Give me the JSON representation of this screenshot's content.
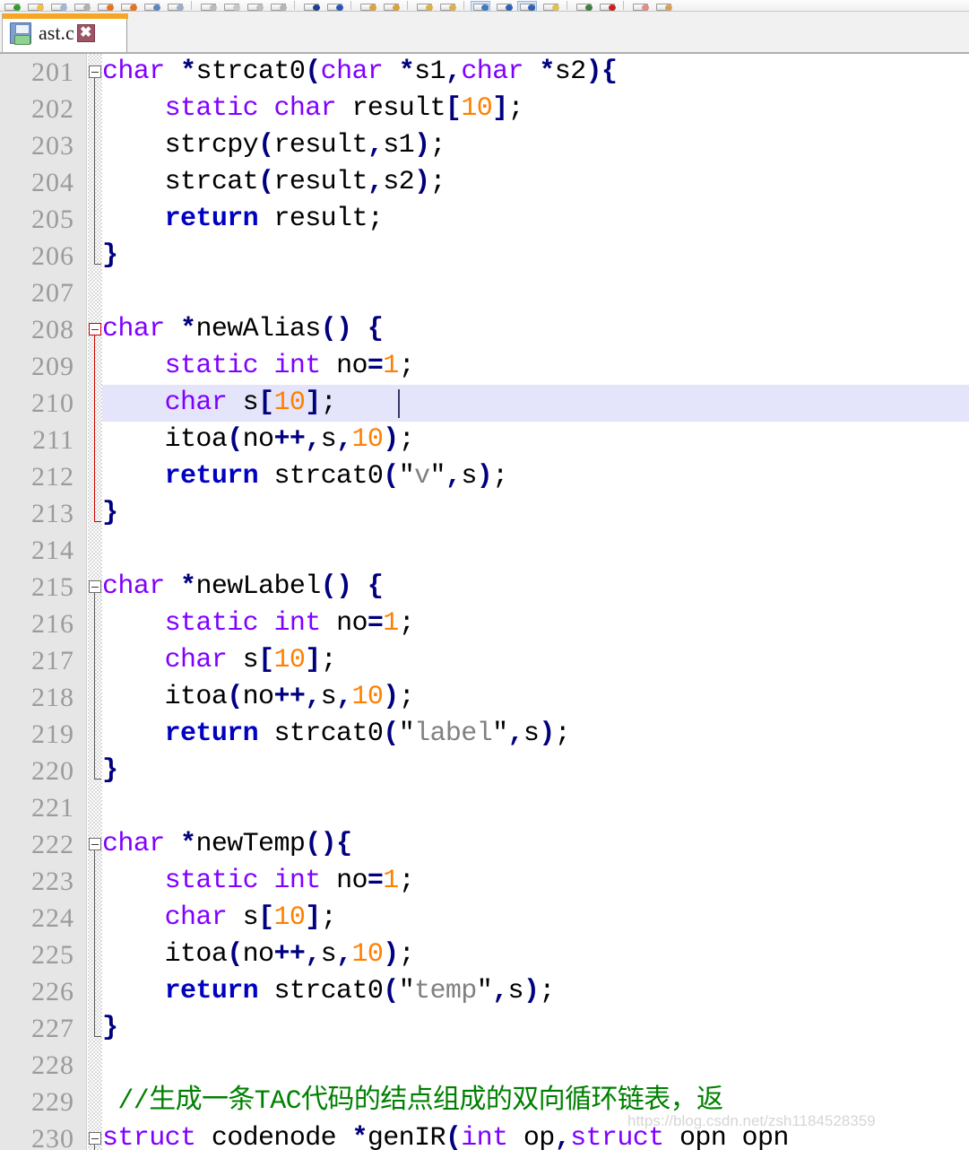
{
  "toolbar": {
    "buttons": [
      {
        "name": "new-file-icon",
        "accent": "#2e9e2e"
      },
      {
        "name": "open-folder-icon",
        "accent": "#f0c040"
      },
      {
        "name": "save-icon",
        "accent": "#9fb8d8"
      },
      {
        "name": "save-all-icon",
        "accent": "#b0b0b0"
      },
      {
        "name": "print-icon",
        "accent": "#e8731c"
      },
      {
        "name": "print-preview-icon",
        "accent": "#e8731c"
      },
      {
        "name": "undo-icon",
        "accent": "#5b86c4"
      },
      {
        "name": "redo-icon",
        "accent": "#9aaec6"
      },
      {
        "name": "cut-icon",
        "accent": "#b9b9b9"
      },
      {
        "name": "copy-icon",
        "accent": "#c7c7c7"
      },
      {
        "name": "paste-icon",
        "accent": "#bdbdbd"
      },
      {
        "name": "delete-icon",
        "accent": "#b5b5b5"
      },
      {
        "name": "find-icon",
        "accent": "#1d3f8f"
      },
      {
        "name": "find-next-icon",
        "accent": "#2a55b5"
      },
      {
        "name": "zoom-in-icon",
        "accent": "#d8a33a"
      },
      {
        "name": "zoom-out-icon",
        "accent": "#d8a33a"
      },
      {
        "name": "bookmark-icon",
        "accent": "#d9b24a"
      },
      {
        "name": "bookmark-next-icon",
        "accent": "#d9b24a"
      },
      {
        "name": "compile-icon",
        "accent": "#3f79c8"
      },
      {
        "name": "run-icon",
        "accent": "#2f60b8"
      },
      {
        "name": "compile-run-icon",
        "accent": "#2f60b8"
      },
      {
        "name": "rebuild-icon",
        "accent": "#e0c050"
      },
      {
        "name": "debug-icon",
        "accent": "#3f7f3f"
      },
      {
        "name": "stop-icon",
        "accent": "#cc2020"
      },
      {
        "name": "profile-icon",
        "accent": "#e08a8a"
      },
      {
        "name": "options-icon",
        "accent": "#d9a05a"
      }
    ]
  },
  "tab": {
    "label": "ast.c",
    "close_label": "✖",
    "accent_color": "#f5a623",
    "save_icon": "floppy-disk-icon"
  },
  "editor": {
    "watermark": "https://blog.csdn.net/zsh1184528359",
    "current_line": 210,
    "lines": [
      {
        "no": "201",
        "fold": "start",
        "active": false
      },
      {
        "no": "202"
      },
      {
        "no": "203"
      },
      {
        "no": "204"
      },
      {
        "no": "205"
      },
      {
        "no": "206",
        "fold": "end"
      },
      {
        "no": "207"
      },
      {
        "no": "208",
        "fold": "start",
        "active": true
      },
      {
        "no": "209"
      },
      {
        "no": "210",
        "highlight": true
      },
      {
        "no": "211"
      },
      {
        "no": "212"
      },
      {
        "no": "213",
        "fold": "end",
        "active": true
      },
      {
        "no": "214"
      },
      {
        "no": "215",
        "fold": "start"
      },
      {
        "no": "216"
      },
      {
        "no": "217"
      },
      {
        "no": "218"
      },
      {
        "no": "219"
      },
      {
        "no": "220",
        "fold": "end"
      },
      {
        "no": "221"
      },
      {
        "no": "222",
        "fold": "start"
      },
      {
        "no": "223"
      },
      {
        "no": "224"
      },
      {
        "no": "225"
      },
      {
        "no": "226"
      },
      {
        "no": "227",
        "fold": "end"
      },
      {
        "no": "228"
      },
      {
        "no": "229"
      },
      {
        "no": "230",
        "fold": "start"
      }
    ],
    "code_text": [
      "char *strcat0(char *s1,char *s2){",
      "    static char result[10];",
      "    strcpy(result,s1);",
      "    strcat(result,s2);",
      "    return result;",
      "}",
      "",
      "char *newAlias() {",
      "    static int no=1;",
      "    char s[10];",
      "    itoa(no++,s,10);",
      "    return strcat0(\"v\",s);",
      "}",
      "",
      "char *newLabel() {",
      "    static int no=1;",
      "    char s[10];",
      "    itoa(no++,s,10);",
      "    return strcat0(\"label\",s);",
      "}",
      "",
      "char *newTemp(){",
      "    static int no=1;",
      "    char s[10];",
      "    itoa(no++,s,10);",
      "    return strcat0(\"temp\",s);",
      "}",
      "",
      "//生成一条TAC代码的结点组成的双向循环链表，返",
      "struct codenode *genIR(int op,struct opn opn"
    ],
    "tokens": [
      [
        [
          "char",
          "k"
        ],
        [
          " ",
          "t"
        ],
        [
          "*",
          "p"
        ],
        [
          "strcat0",
          "t"
        ],
        [
          "(",
          "p"
        ],
        [
          "char",
          "k"
        ],
        [
          " ",
          "t"
        ],
        [
          "*",
          "p"
        ],
        [
          "s1",
          "t"
        ],
        [
          ",",
          "p"
        ],
        [
          "char",
          "k"
        ],
        [
          " ",
          "t"
        ],
        [
          "*",
          "p"
        ],
        [
          "s2",
          "t"
        ],
        [
          ")",
          "p"
        ],
        [
          "{",
          "p"
        ]
      ],
      [
        [
          "    ",
          "t"
        ],
        [
          "static",
          "k"
        ],
        [
          " ",
          "t"
        ],
        [
          "char",
          "k"
        ],
        [
          " result",
          "t"
        ],
        [
          "[",
          "p"
        ],
        [
          "10",
          "n"
        ],
        [
          "]",
          "p"
        ],
        [
          ";",
          "t"
        ]
      ],
      [
        [
          "    strcpy",
          "t"
        ],
        [
          "(",
          "p"
        ],
        [
          "result",
          "t"
        ],
        [
          ",",
          "p"
        ],
        [
          "s1",
          "t"
        ],
        [
          ")",
          "p"
        ],
        [
          ";",
          "t"
        ]
      ],
      [
        [
          "    strcat",
          "t"
        ],
        [
          "(",
          "p"
        ],
        [
          "result",
          "t"
        ],
        [
          ",",
          "p"
        ],
        [
          "s2",
          "t"
        ],
        [
          ")",
          "p"
        ],
        [
          ";",
          "t"
        ]
      ],
      [
        [
          "    ",
          "t"
        ],
        [
          "return",
          "kb"
        ],
        [
          " result;",
          "t"
        ]
      ],
      [
        [
          "}",
          "p"
        ]
      ],
      [],
      [
        [
          "char",
          "k"
        ],
        [
          " ",
          "t"
        ],
        [
          "*",
          "p"
        ],
        [
          "newAlias",
          "t"
        ],
        [
          "()",
          "p"
        ],
        [
          " ",
          "t"
        ],
        [
          "{",
          "p"
        ]
      ],
      [
        [
          "    ",
          "t"
        ],
        [
          "static",
          "k"
        ],
        [
          " ",
          "t"
        ],
        [
          "int",
          "k"
        ],
        [
          " no",
          "t"
        ],
        [
          "=",
          "p"
        ],
        [
          "1",
          "n"
        ],
        [
          ";",
          "t"
        ]
      ],
      [
        [
          "    ",
          "t"
        ],
        [
          "char",
          "k"
        ],
        [
          " s",
          "t"
        ],
        [
          "[",
          "p"
        ],
        [
          "10",
          "n"
        ],
        [
          "]",
          "p"
        ],
        [
          ";",
          "t"
        ]
      ],
      [
        [
          "    itoa",
          "t"
        ],
        [
          "(",
          "p"
        ],
        [
          "no",
          "t"
        ],
        [
          "++",
          "p"
        ],
        [
          ",",
          "p"
        ],
        [
          "s",
          "t"
        ],
        [
          ",",
          "p"
        ],
        [
          "10",
          "n"
        ],
        [
          ")",
          "p"
        ],
        [
          ";",
          "t"
        ]
      ],
      [
        [
          "    ",
          "t"
        ],
        [
          "return",
          "kb"
        ],
        [
          " strcat0",
          "t"
        ],
        [
          "(",
          "p"
        ],
        [
          "\"",
          "q"
        ],
        [
          "v",
          "s"
        ],
        [
          "\"",
          "q"
        ],
        [
          ",",
          "p"
        ],
        [
          "s",
          "t"
        ],
        [
          ")",
          "p"
        ],
        [
          ";",
          "t"
        ]
      ],
      [
        [
          "}",
          "p"
        ]
      ],
      [],
      [
        [
          "char",
          "k"
        ],
        [
          " ",
          "t"
        ],
        [
          "*",
          "p"
        ],
        [
          "newLabel",
          "t"
        ],
        [
          "()",
          "p"
        ],
        [
          " ",
          "t"
        ],
        [
          "{",
          "p"
        ]
      ],
      [
        [
          "    ",
          "t"
        ],
        [
          "static",
          "k"
        ],
        [
          " ",
          "t"
        ],
        [
          "int",
          "k"
        ],
        [
          " no",
          "t"
        ],
        [
          "=",
          "p"
        ],
        [
          "1",
          "n"
        ],
        [
          ";",
          "t"
        ]
      ],
      [
        [
          "    ",
          "t"
        ],
        [
          "char",
          "k"
        ],
        [
          " s",
          "t"
        ],
        [
          "[",
          "p"
        ],
        [
          "10",
          "n"
        ],
        [
          "]",
          "p"
        ],
        [
          ";",
          "t"
        ]
      ],
      [
        [
          "    itoa",
          "t"
        ],
        [
          "(",
          "p"
        ],
        [
          "no",
          "t"
        ],
        [
          "++",
          "p"
        ],
        [
          ",",
          "p"
        ],
        [
          "s",
          "t"
        ],
        [
          ",",
          "p"
        ],
        [
          "10",
          "n"
        ],
        [
          ")",
          "p"
        ],
        [
          ";",
          "t"
        ]
      ],
      [
        [
          "    ",
          "t"
        ],
        [
          "return",
          "kb"
        ],
        [
          " strcat0",
          "t"
        ],
        [
          "(",
          "p"
        ],
        [
          "\"",
          "q"
        ],
        [
          "label",
          "s"
        ],
        [
          "\"",
          "q"
        ],
        [
          ",",
          "p"
        ],
        [
          "s",
          "t"
        ],
        [
          ")",
          "p"
        ],
        [
          ";",
          "t"
        ]
      ],
      [
        [
          "}",
          "p"
        ]
      ],
      [],
      [
        [
          "char",
          "k"
        ],
        [
          " ",
          "t"
        ],
        [
          "*",
          "p"
        ],
        [
          "newTemp",
          "t"
        ],
        [
          "()",
          "p"
        ],
        [
          "{",
          "p"
        ]
      ],
      [
        [
          "    ",
          "t"
        ],
        [
          "static",
          "k"
        ],
        [
          " ",
          "t"
        ],
        [
          "int",
          "k"
        ],
        [
          " no",
          "t"
        ],
        [
          "=",
          "p"
        ],
        [
          "1",
          "n"
        ],
        [
          ";",
          "t"
        ]
      ],
      [
        [
          "    ",
          "t"
        ],
        [
          "char",
          "k"
        ],
        [
          " s",
          "t"
        ],
        [
          "[",
          "p"
        ],
        [
          "10",
          "n"
        ],
        [
          "]",
          "p"
        ],
        [
          ";",
          "t"
        ]
      ],
      [
        [
          "    itoa",
          "t"
        ],
        [
          "(",
          "p"
        ],
        [
          "no",
          "t"
        ],
        [
          "++",
          "p"
        ],
        [
          ",",
          "p"
        ],
        [
          "s",
          "t"
        ],
        [
          ",",
          "p"
        ],
        [
          "10",
          "n"
        ],
        [
          ")",
          "p"
        ],
        [
          ";",
          "t"
        ]
      ],
      [
        [
          "    ",
          "t"
        ],
        [
          "return",
          "kb"
        ],
        [
          " strcat0",
          "t"
        ],
        [
          "(",
          "p"
        ],
        [
          "\"",
          "q"
        ],
        [
          "temp",
          "s"
        ],
        [
          "\"",
          "q"
        ],
        [
          ",",
          "p"
        ],
        [
          "s",
          "t"
        ],
        [
          ")",
          "p"
        ],
        [
          ";",
          "t"
        ]
      ],
      [
        [
          "}",
          "p"
        ]
      ],
      [],
      [
        [
          " //生成一条TAC代码的结点组成的双向循环链表，返",
          "c"
        ]
      ],
      [
        [
          "struct",
          "k"
        ],
        [
          " codenode ",
          "t"
        ],
        [
          "*",
          "p"
        ],
        [
          "genIR",
          "t"
        ],
        [
          "(",
          "p"
        ],
        [
          "int",
          "k"
        ],
        [
          " op",
          "t"
        ],
        [
          ",",
          "p"
        ],
        [
          "struct",
          "k"
        ],
        [
          " opn opn",
          "t"
        ]
      ]
    ],
    "colors": {
      "keyword_type": "#8000ff",
      "keyword_control": "#0000c0",
      "punctuation": "#00007f",
      "number": "#ff8000",
      "string": "#808080",
      "comment": "#008000",
      "line_number": "#9b9b9b",
      "gutter_bg": "#e6e6e6",
      "current_line_bg": "#e4e4fa",
      "fold_active": "#cc0000"
    }
  }
}
